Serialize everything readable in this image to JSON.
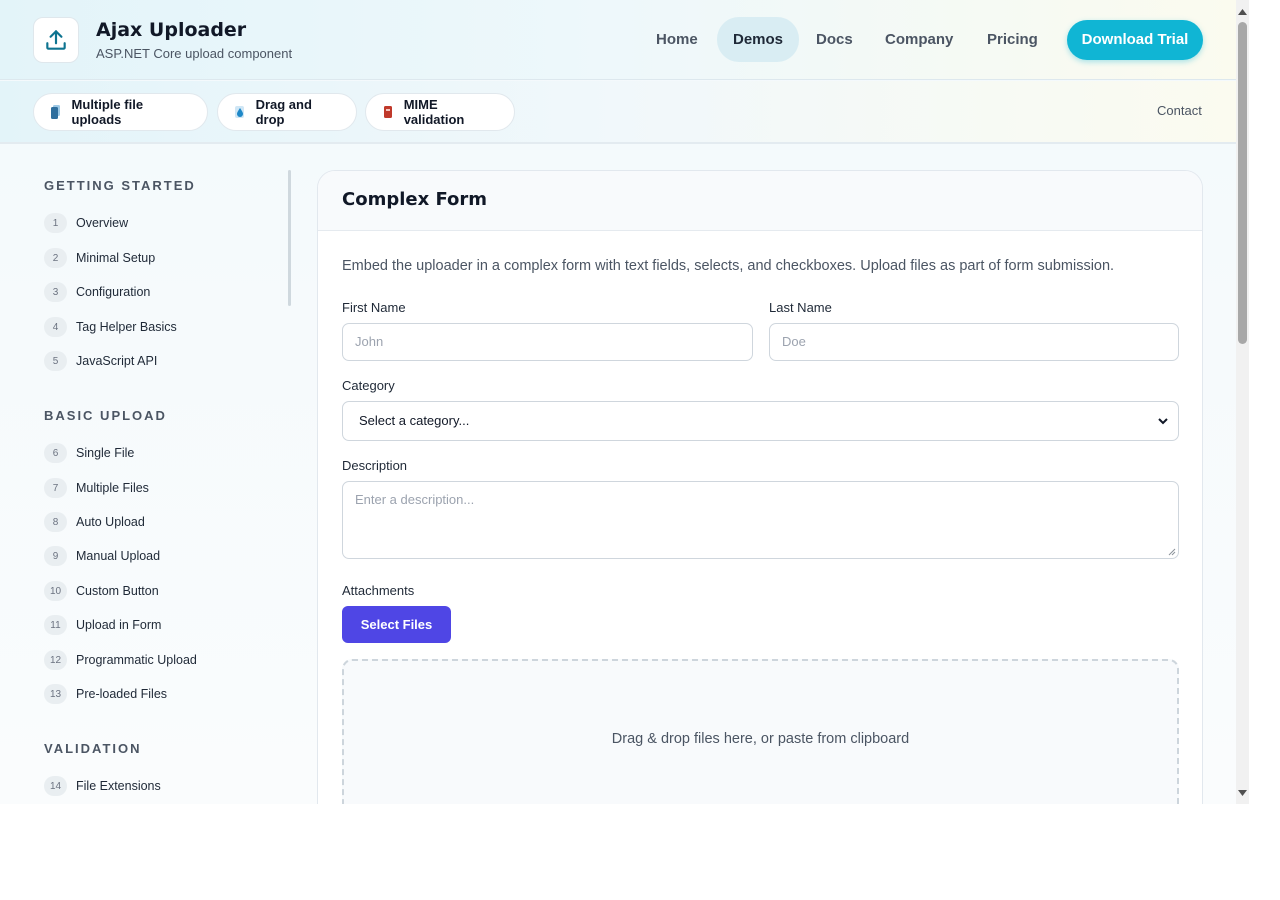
{
  "header": {
    "brand_title": "Ajax Uploader",
    "brand_subtitle": "ASP.NET Core upload component",
    "logo_icon": "upload-icon",
    "nav": [
      {
        "label": "Home",
        "active": false
      },
      {
        "label": "Demos",
        "active": true
      },
      {
        "label": "Docs",
        "active": false
      },
      {
        "label": "Company",
        "active": false
      },
      {
        "label": "Pricing",
        "active": false
      }
    ],
    "cta_label": "Download Trial",
    "accent_color": "#10b5d4"
  },
  "subbar": {
    "pills": [
      {
        "label": "Multiple file uploads",
        "icon": "files-icon"
      },
      {
        "label": "Drag and drop",
        "icon": "drop-icon"
      },
      {
        "label": "MIME validation",
        "icon": "file-badge-icon"
      }
    ],
    "contact_label": "Contact"
  },
  "sidebar": {
    "sections": [
      {
        "title": "GETTING STARTED",
        "items": [
          {
            "num": "1",
            "label": "Overview"
          },
          {
            "num": "2",
            "label": "Minimal Setup"
          },
          {
            "num": "3",
            "label": "Configuration"
          },
          {
            "num": "4",
            "label": "Tag Helper Basics"
          },
          {
            "num": "5",
            "label": "JavaScript API"
          }
        ]
      },
      {
        "title": "BASIC UPLOAD",
        "items": [
          {
            "num": "6",
            "label": "Single File"
          },
          {
            "num": "7",
            "label": "Multiple Files"
          },
          {
            "num": "8",
            "label": "Auto Upload"
          },
          {
            "num": "9",
            "label": "Manual Upload"
          },
          {
            "num": "10",
            "label": "Custom Button"
          },
          {
            "num": "11",
            "label": "Upload in Form"
          },
          {
            "num": "12",
            "label": "Programmatic Upload"
          },
          {
            "num": "13",
            "label": "Pre-loaded Files"
          }
        ]
      },
      {
        "title": "VALIDATION",
        "items": [
          {
            "num": "14",
            "label": "File Extensions"
          }
        ]
      }
    ]
  },
  "main": {
    "title": "Complex Form",
    "description": "Embed the uploader in a complex form with text fields, selects, and checkboxes. Upload files as part of form submission.",
    "first_name": {
      "label": "First Name",
      "placeholder": "John",
      "value": ""
    },
    "last_name": {
      "label": "Last Name",
      "placeholder": "Doe",
      "value": ""
    },
    "category": {
      "label": "Category",
      "selected": "Select a category..."
    },
    "description_field": {
      "label": "Description",
      "placeholder": "Enter a description..."
    },
    "attachments": {
      "label": "Attachments",
      "button_label": "Select Files",
      "button_color": "#4f46e5"
    },
    "dropzone_text": "Drag & drop files here, or paste from clipboard"
  }
}
